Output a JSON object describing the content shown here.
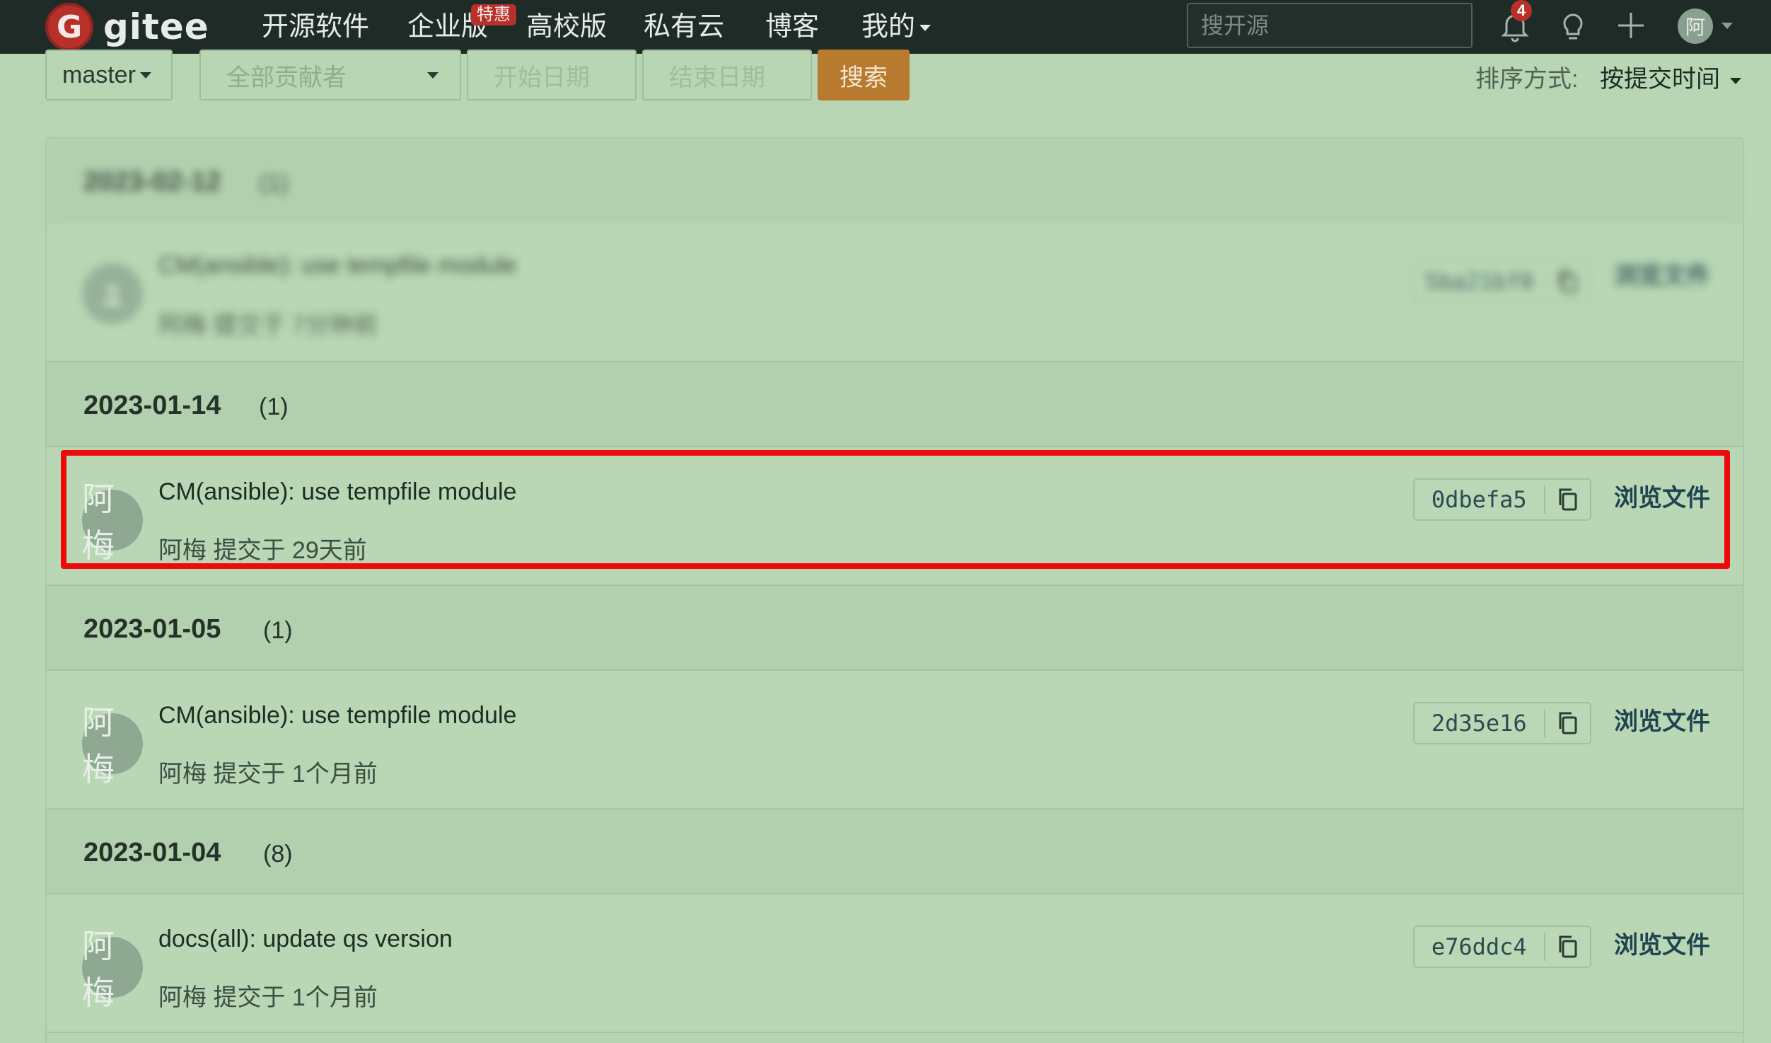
{
  "nav": {
    "logo_letter": "G",
    "logo_text": "gitee",
    "items": [
      {
        "label": "开源软件"
      },
      {
        "label": "企业版",
        "badge": "特惠"
      },
      {
        "label": "高校版"
      },
      {
        "label": "私有云"
      },
      {
        "label": "博客"
      },
      {
        "label": "我的"
      }
    ],
    "search_placeholder": "搜开源",
    "notification_count": "4",
    "avatar_initial": "阿",
    "icons": [
      "bell-icon",
      "lightbulb-icon",
      "plus-icon",
      "chevron-down-icon"
    ]
  },
  "filters": {
    "branch": "master",
    "contributors_placeholder": "全部贡献者",
    "start_date_placeholder": "开始日期",
    "end_date_placeholder": "结束日期",
    "search_button": "搜索",
    "sort_label": "排序方式:",
    "sort_value": "按提交时间"
  },
  "groups": [
    {
      "date": "2023-02-12",
      "count": "(1)",
      "blurred": true,
      "commits": [
        {
          "title": "CM(ansible): use tempfile module",
          "author": "阿梅",
          "action": "提交于",
          "time": "7分钟前",
          "sha": "5ba21bf0",
          "browse": "浏览文件"
        }
      ]
    },
    {
      "date": "2023-01-14",
      "count": "(1)",
      "commits": [
        {
          "title": "CM(ansible): use tempfile module",
          "author": "阿梅",
          "action": "提交于",
          "time": "29天前",
          "sha": "0dbefa5",
          "browse": "浏览文件",
          "highlighted": true
        }
      ]
    },
    {
      "date": "2023-01-05",
      "count": "(1)",
      "commits": [
        {
          "title": "CM(ansible): use tempfile module",
          "author": "阿梅",
          "action": "提交于",
          "time": "1个月前",
          "sha": "2d35e16",
          "browse": "浏览文件"
        }
      ]
    },
    {
      "date": "2023-01-04",
      "count": "(8)",
      "commits": [
        {
          "title": "docs(all): update qs version",
          "author": "阿梅",
          "action": "提交于",
          "time": "1个月前",
          "sha": "e76ddc4",
          "browse": "浏览文件"
        }
      ]
    }
  ],
  "colors": {
    "page_bg": "#b8d6b3",
    "nav_bg": "#1f2b27",
    "brand_red": "#b8302a",
    "search_button": "#b87a2e",
    "highlight": "#ee0a0a"
  }
}
